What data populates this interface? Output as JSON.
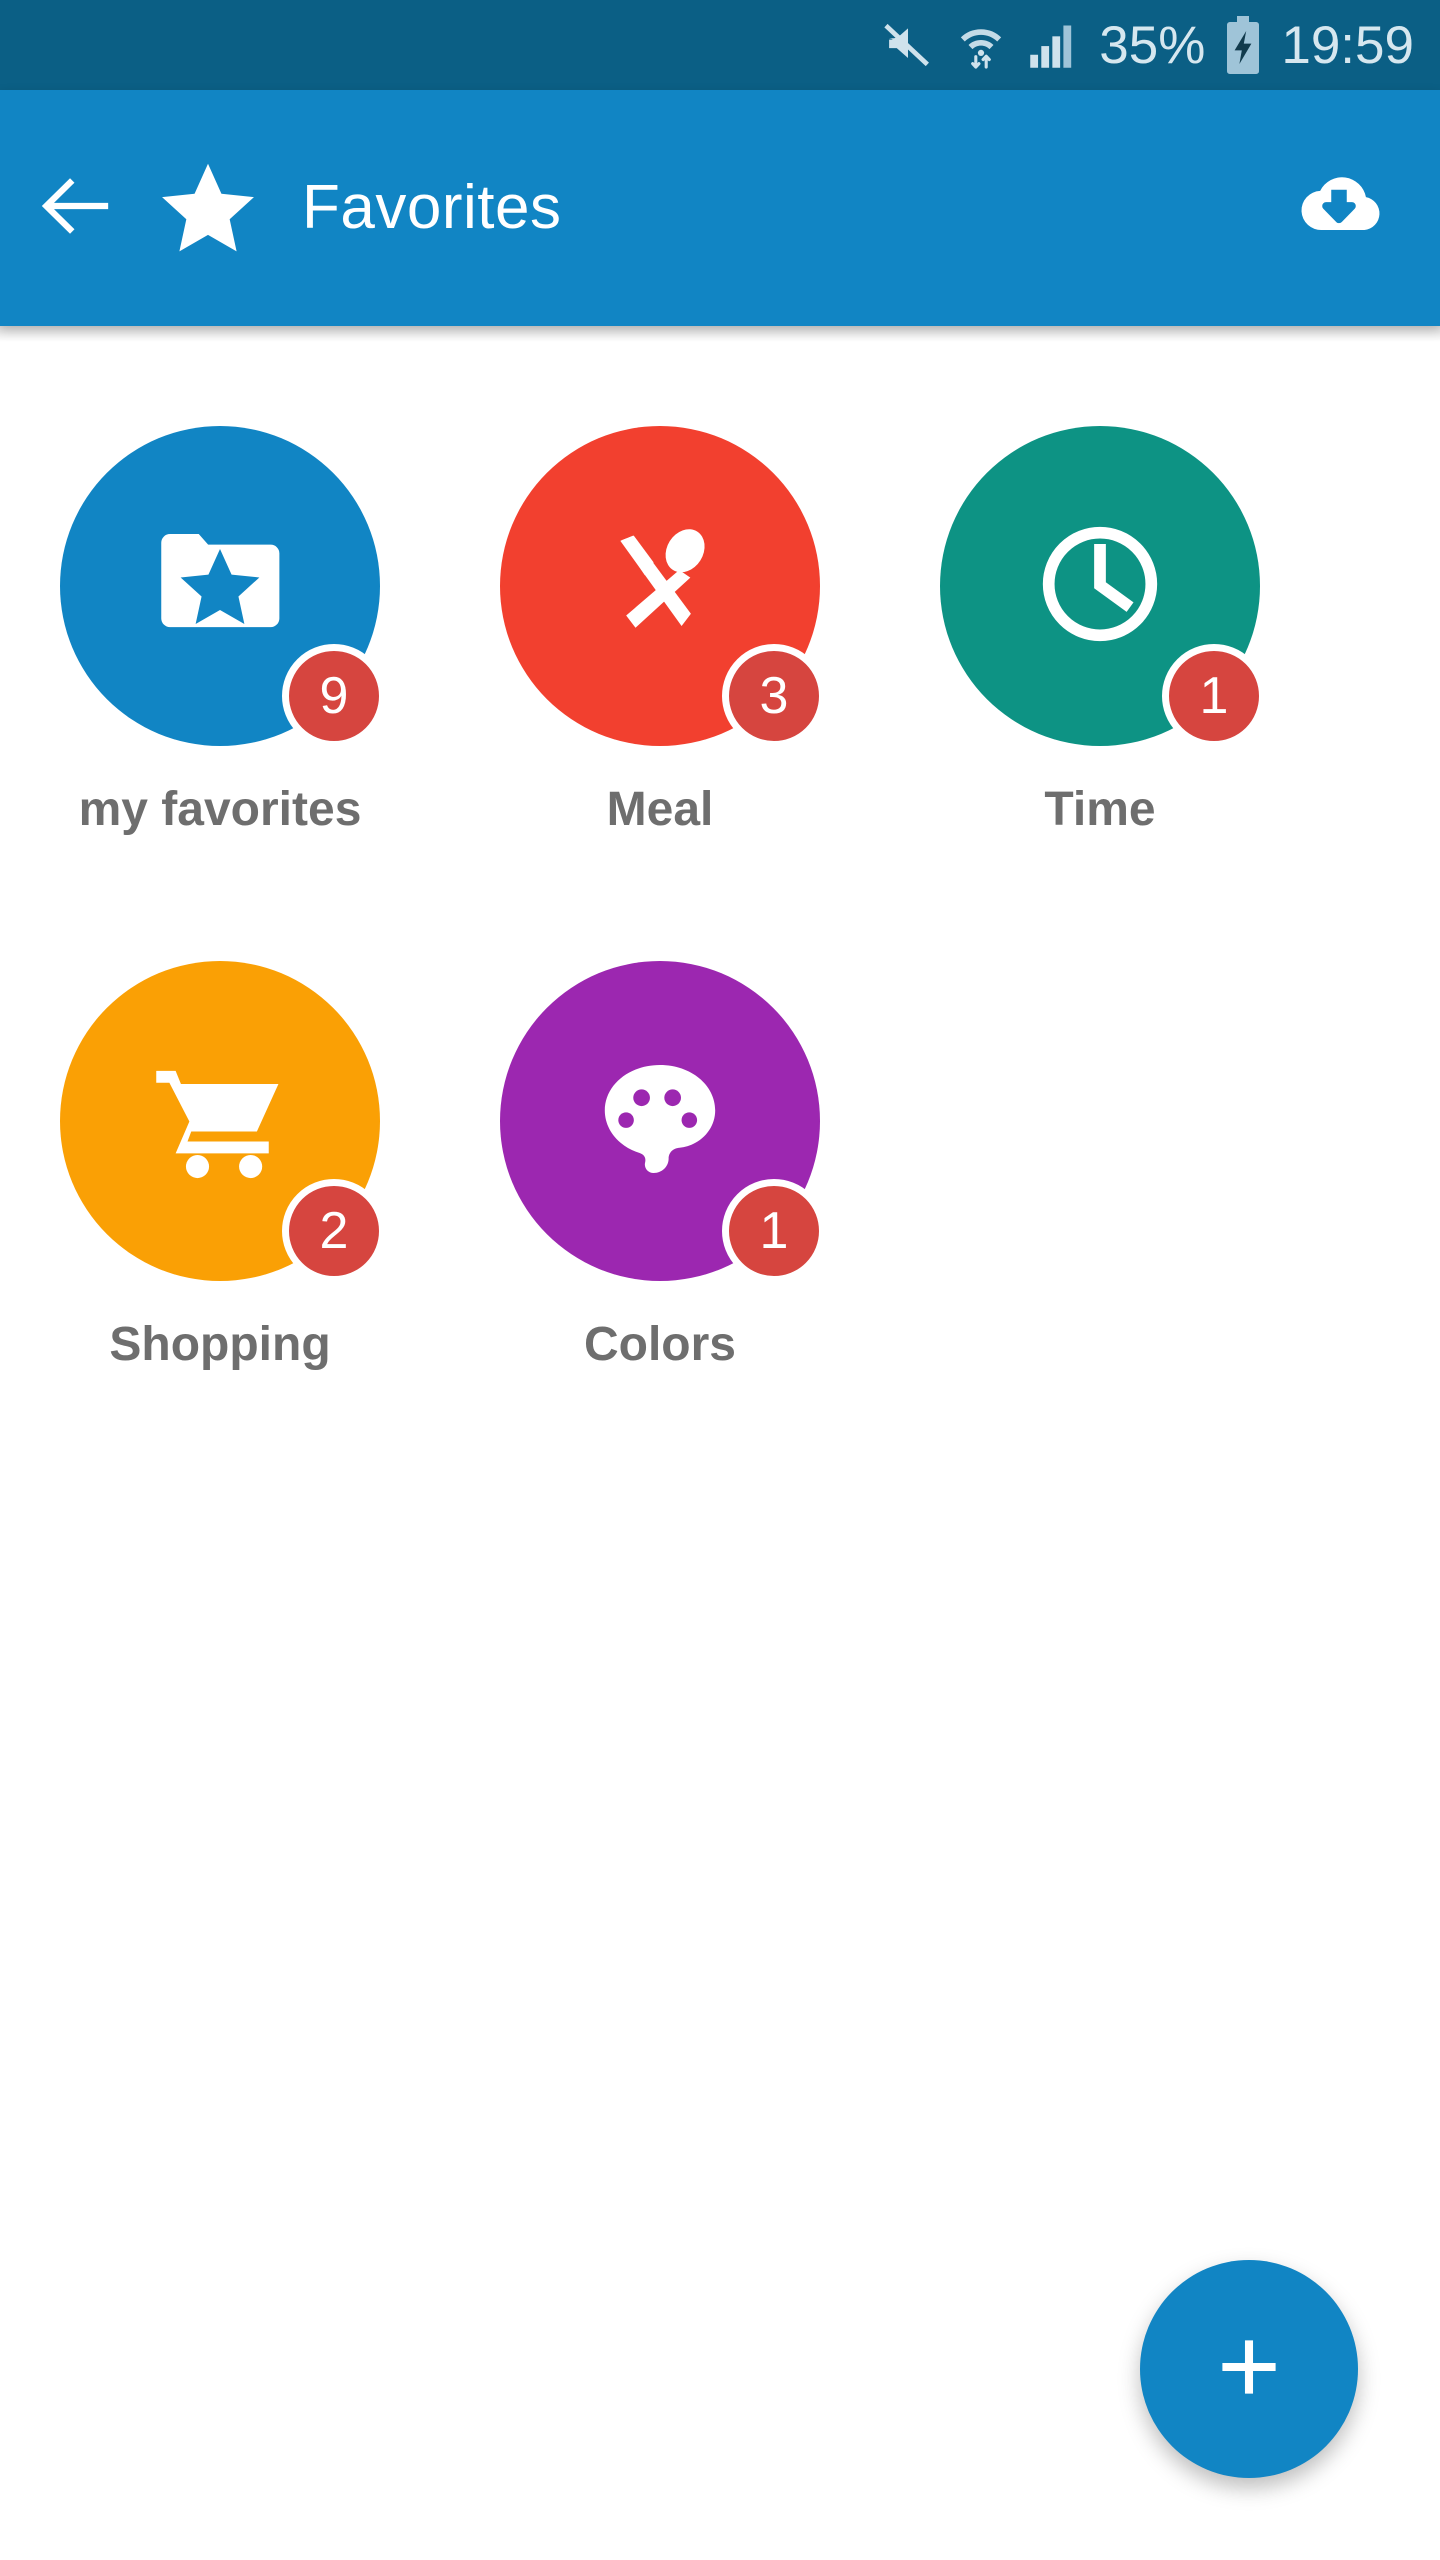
{
  "status_bar": {
    "background": "#0b5f85",
    "text_color": "#d6e7ef",
    "mute_icon": "volume-mute-icon",
    "wifi_icon": "wifi-transfer-icon",
    "signal_icon": "cellular-signal-icon",
    "battery_percent": "35%",
    "battery_icon": "battery-charging-icon",
    "time": "19:59"
  },
  "app_bar": {
    "background": "#1185c4",
    "back_icon": "arrow-back-icon",
    "star_icon": "star-icon",
    "title": "Favorites",
    "action_icon": "cloud-download-icon"
  },
  "grid": {
    "items": [
      {
        "label": "my favorites",
        "badge": "9",
        "color": "#1185c4",
        "icon": "folder-star-icon"
      },
      {
        "label": "Meal",
        "badge": "3",
        "color": "#f2402f",
        "icon": "restaurant-cutlery-icon"
      },
      {
        "label": "Time",
        "badge": "1",
        "color": "#0d9384",
        "icon": "clock-icon"
      },
      {
        "label": "Shopping",
        "badge": "2",
        "color": "#faa005",
        "icon": "shopping-cart-icon"
      },
      {
        "label": "Colors",
        "badge": "1",
        "color": "#9c27b0",
        "icon": "color-palette-icon"
      }
    ],
    "badge_color": "#d6453f",
    "label_color": "#6e6e6e"
  },
  "fab": {
    "icon": "plus-icon",
    "color": "#1185c4",
    "label": "+"
  }
}
